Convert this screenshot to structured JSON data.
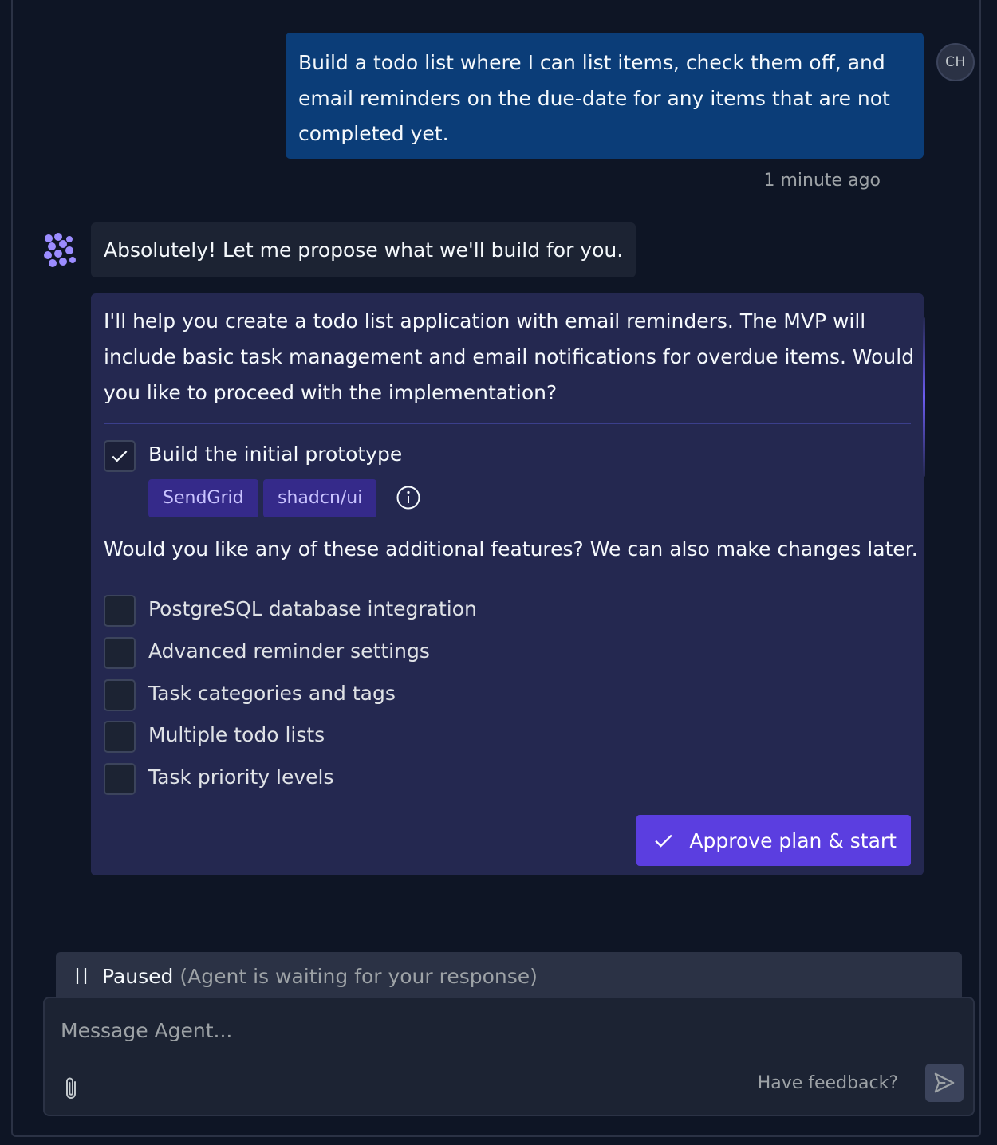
{
  "user_message": {
    "text": "Build a todo list where I can list items, check them off, and email reminders on the due-date for any items that are not completed yet.",
    "avatar_initials": "CH",
    "timestamp": "1 minute ago"
  },
  "agent": {
    "reply": "Absolutely! Let me propose what we'll build for you.",
    "plan": {
      "intro": "I'll help you create a todo list application with email reminders. The MVP will include basic task management and email notifications for overdue items. Would you like to proceed with the implementation?",
      "primary_task": {
        "label": "Build the initial prototype",
        "checked": true
      },
      "tags": [
        "SendGrid",
        "shadcn/ui"
      ],
      "features_question": "Would you like any of these additional features? We can also make changes later.",
      "features": [
        {
          "label": "PostgreSQL database integration",
          "checked": false
        },
        {
          "label": "Advanced reminder settings",
          "checked": false
        },
        {
          "label": "Task categories and tags",
          "checked": false
        },
        {
          "label": "Multiple todo lists",
          "checked": false
        },
        {
          "label": "Task priority levels",
          "checked": false
        }
      ],
      "approve_label": "Approve plan & start"
    }
  },
  "status": {
    "label": "Paused",
    "detail": "(Agent is waiting for your response)"
  },
  "composer": {
    "placeholder": "Message Agent...",
    "feedback_label": "Have feedback?"
  },
  "colors": {
    "background": "#0e1525",
    "user_bubble": "#0b3d78",
    "plan_card": "#242850",
    "accent": "#5b3ee0",
    "tag_bg": "#352a8a"
  }
}
